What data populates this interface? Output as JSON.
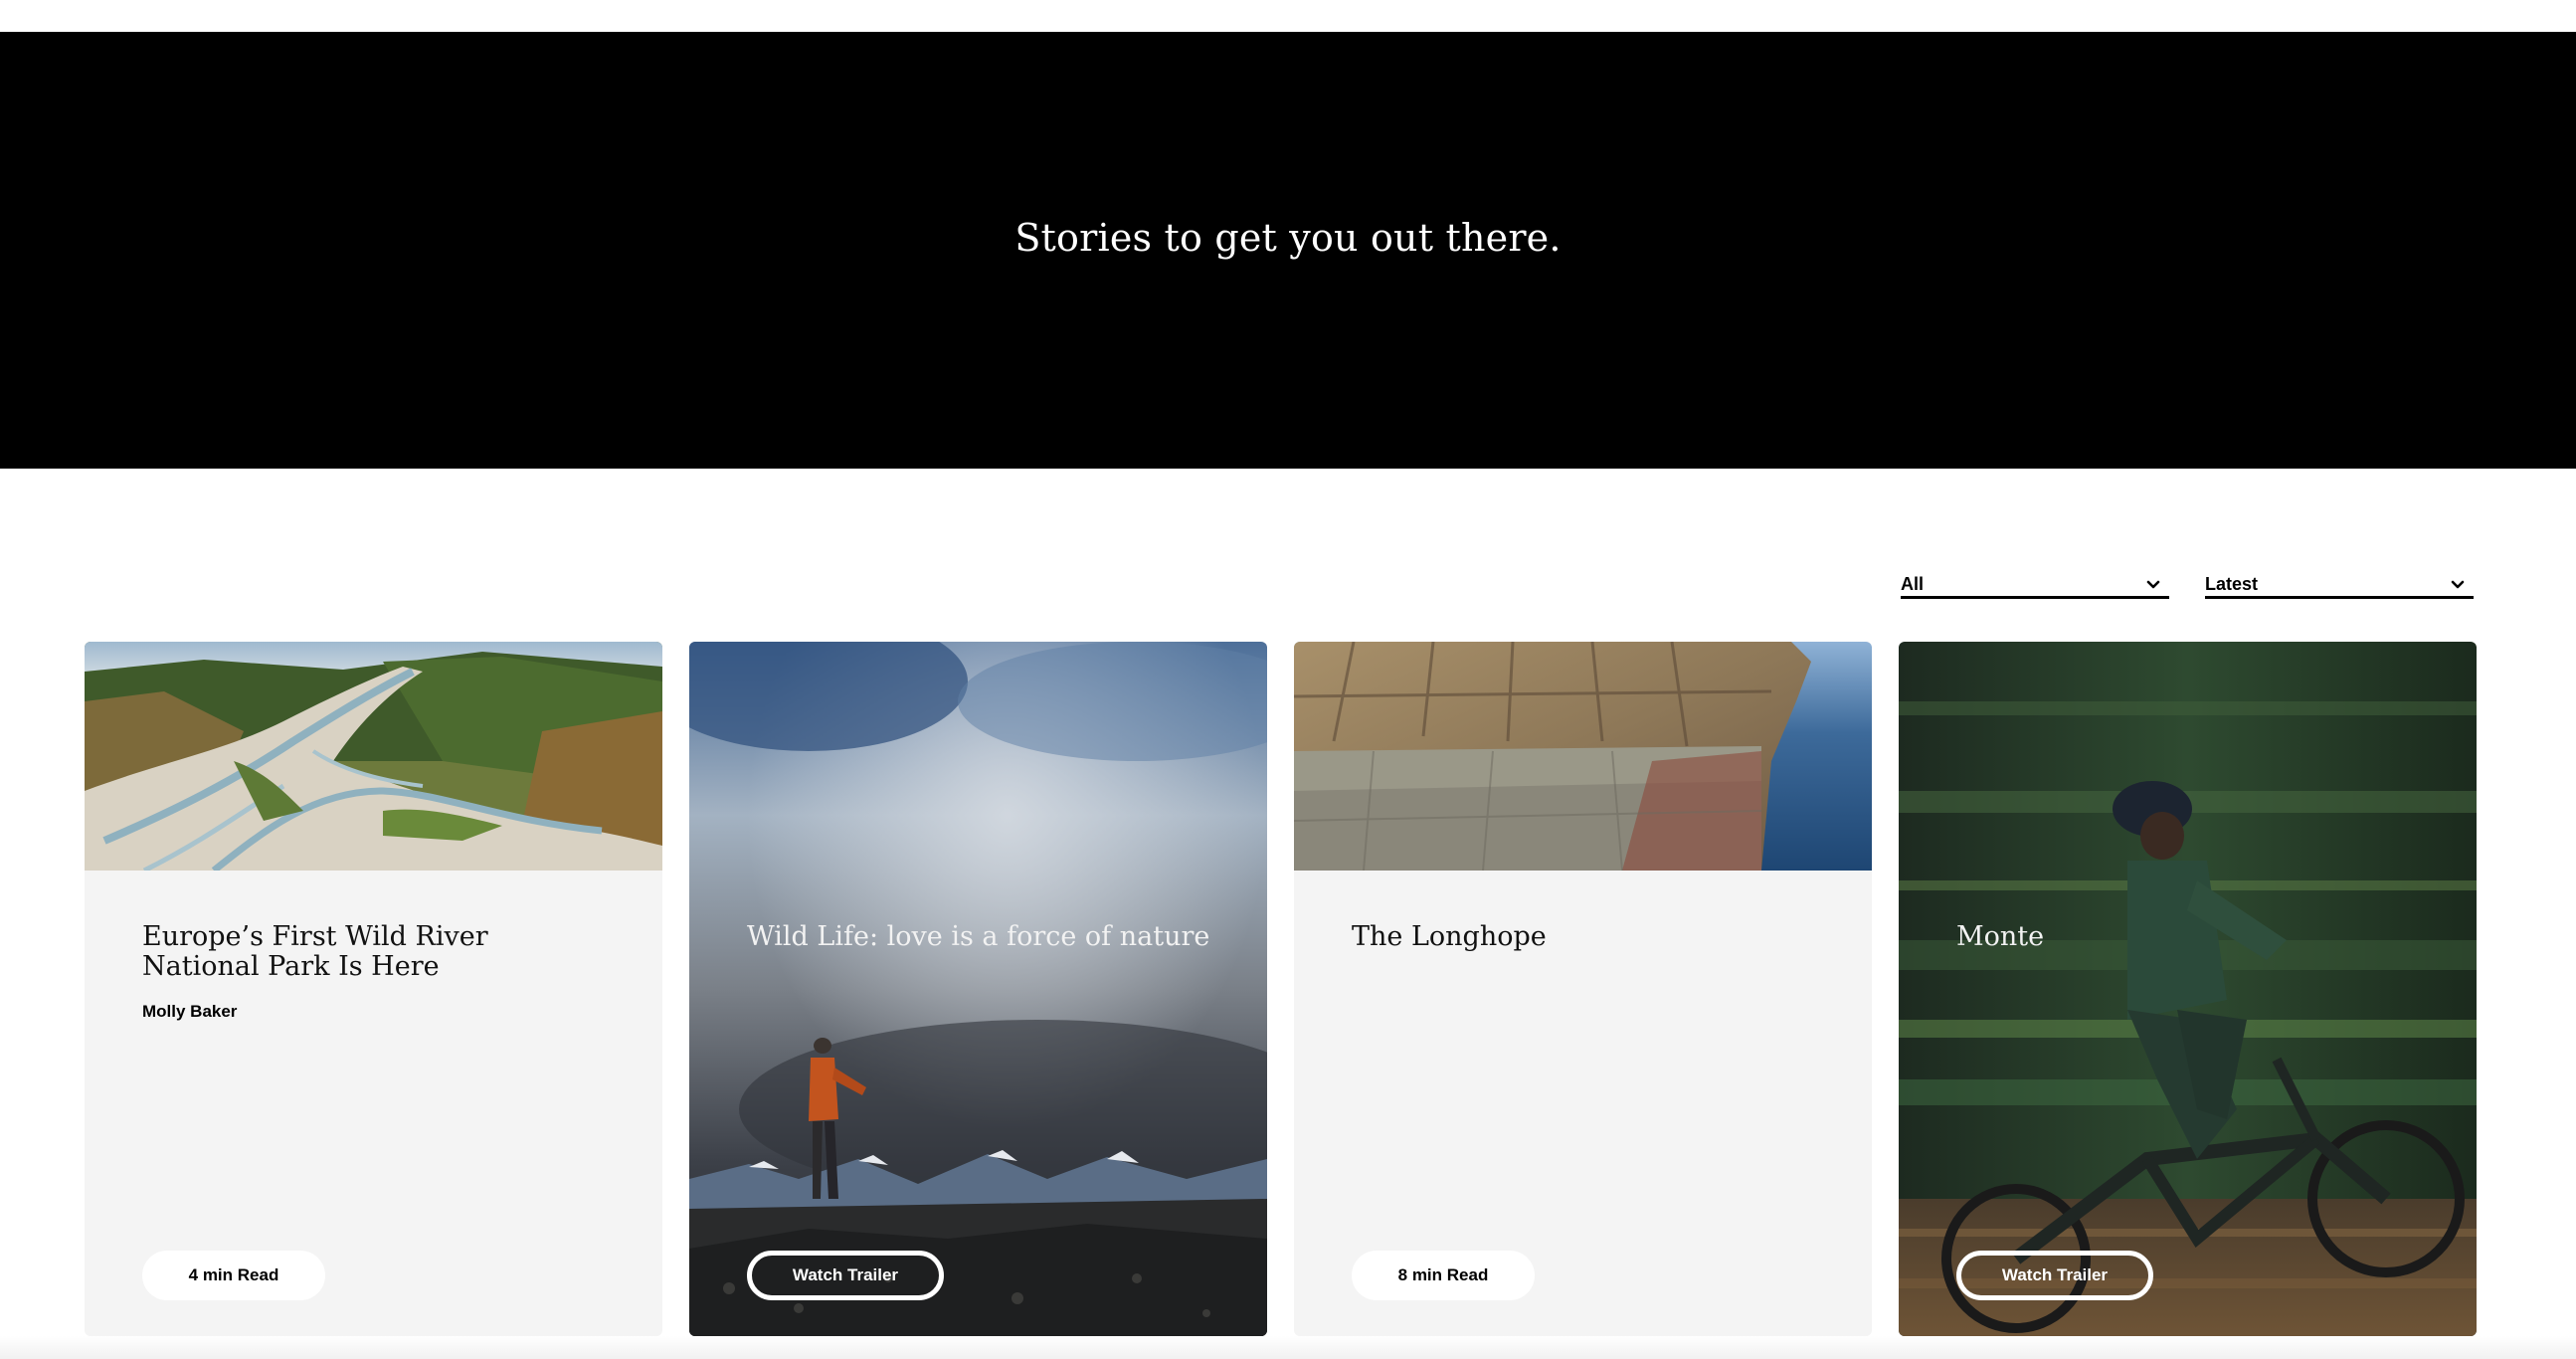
{
  "hero": {
    "title": "Stories to get you out there."
  },
  "filters": {
    "category": {
      "selected": "All",
      "icon": "chevron-down-icon"
    },
    "sort": {
      "selected": "Latest",
      "icon": "chevron-down-icon"
    }
  },
  "cards": [
    {
      "title": "Europe’s First Wild River National Park Is Here",
      "author": "Molly Baker",
      "button": "4 min Read",
      "image": "aerial braided river valley"
    },
    {
      "title": "Wild Life: love is a force of nature",
      "button": "Watch Trailer",
      "image": "hiker on mountain ridge under clouds"
    },
    {
      "title": "The Longhope",
      "button": "8 min Read",
      "image": "sea cliff above ocean"
    },
    {
      "title": "Monte",
      "button": "Watch Trailer",
      "image": "mountain biker motion blur"
    }
  ],
  "colors": {
    "hero_bg": "#000000",
    "card_bg": "#f4f4f4",
    "text_dark": "#111111",
    "text_light": "#f2f2f2"
  }
}
